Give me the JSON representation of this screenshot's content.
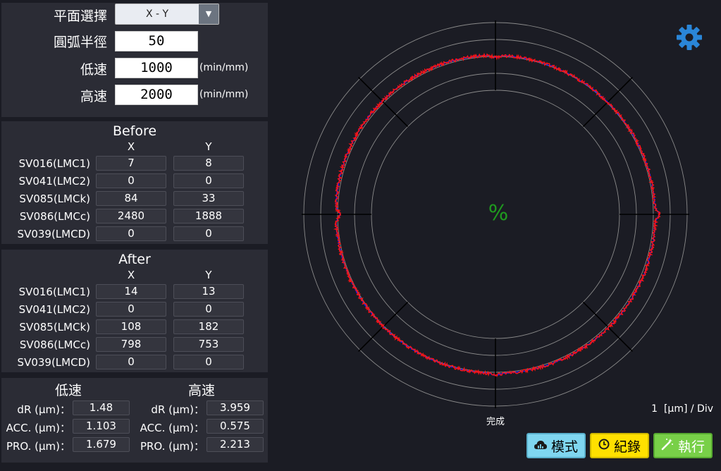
{
  "settings": {
    "plane_label": "平面選擇",
    "plane_value": "X - Y",
    "radius_label": "圓弧半徑",
    "radius_value": "50",
    "low_label": "低速",
    "low_value": "1000",
    "low_unit": "(min/mm)",
    "high_label": "高速",
    "high_value": "2000",
    "high_unit": "(min/mm)"
  },
  "before": {
    "title": "Before",
    "col_x": "X",
    "col_y": "Y",
    "rows": [
      {
        "label": "SV016(LMC1)",
        "x": "7",
        "y": "8"
      },
      {
        "label": "SV041(LMC2)",
        "x": "0",
        "y": "0"
      },
      {
        "label": "SV085(LMCk)",
        "x": "84",
        "y": "33"
      },
      {
        "label": "SV086(LMCc)",
        "x": "2480",
        "y": "1888"
      },
      {
        "label": "SV039(LMCD)",
        "x": "0",
        "y": "0"
      }
    ]
  },
  "after": {
    "title": "After",
    "col_x": "X",
    "col_y": "Y",
    "rows": [
      {
        "label": "SV016(LMC1)",
        "x": "14",
        "y": "13"
      },
      {
        "label": "SV041(LMC2)",
        "x": "0",
        "y": "0"
      },
      {
        "label": "SV085(LMCk)",
        "x": "108",
        "y": "182"
      },
      {
        "label": "SV086(LMCc)",
        "x": "798",
        "y": "753"
      },
      {
        "label": "SV039(LMCD)",
        "x": "0",
        "y": "0"
      }
    ]
  },
  "results": {
    "low_title": "低速",
    "high_title": "高速",
    "low": [
      {
        "label": "dR (µm)：",
        "value": "1.48"
      },
      {
        "label": "ACC. (µm)：",
        "value": "1.103"
      },
      {
        "label": "PRO. (µm)：",
        "value": "1.679"
      }
    ],
    "high": [
      {
        "label": "dR (µm)：",
        "value": "3.959"
      },
      {
        "label": "ACC. (µm)：",
        "value": "0.575"
      },
      {
        "label": "PRO. (µm)：",
        "value": "2.213"
      }
    ]
  },
  "plot": {
    "center_text": "%",
    "status_text": "完成",
    "scale_text": "1  [µm] / Div",
    "gear_icon": "gear-icon",
    "colors": {
      "actual": "#ff1414",
      "reference": "#2020ff",
      "grid": "#8a8a8a",
      "center_text": "#1f9a1f"
    }
  },
  "buttons": {
    "mode": {
      "label": "模式",
      "icon": "cloud-chart-icon",
      "color": "#7fd6f0"
    },
    "record": {
      "label": "紀錄",
      "icon": "clock-icon",
      "color": "#ffe000"
    },
    "execute": {
      "label": "執行",
      "icon": "magic-wand-icon",
      "color": "#78d048"
    }
  }
}
